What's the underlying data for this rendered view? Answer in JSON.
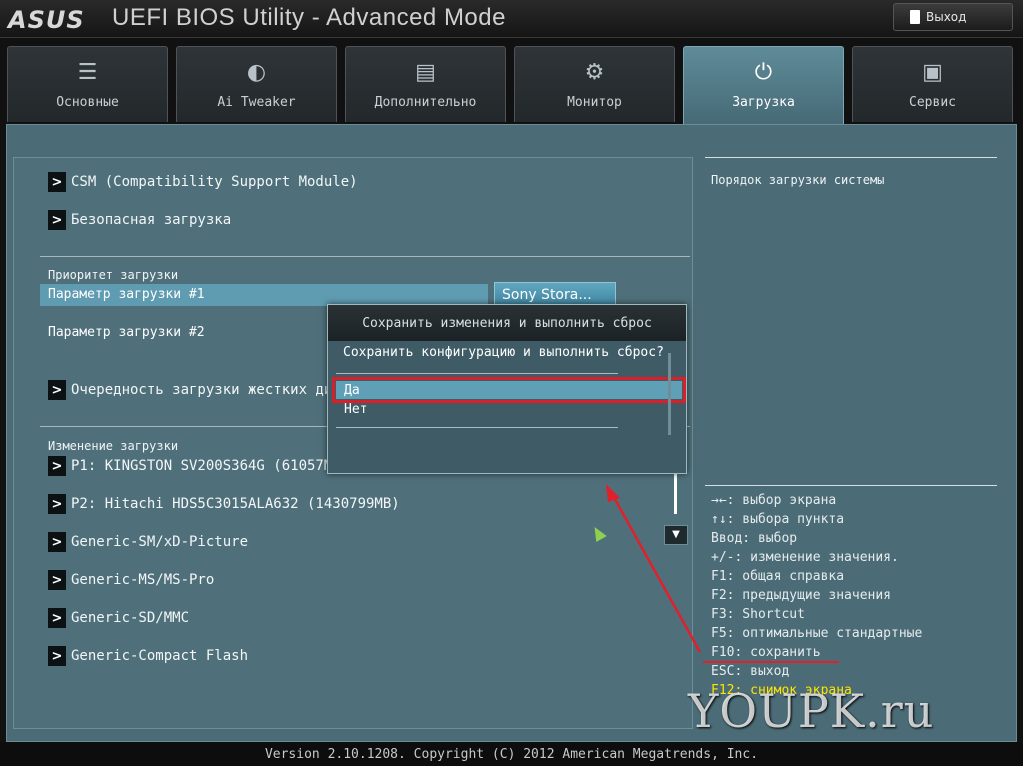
{
  "titlebar": {
    "logo": "ASUS",
    "title": "UEFI BIOS Utility - Advanced Mode",
    "exit_label": "Выход"
  },
  "tabs": [
    {
      "label": "Основные",
      "icon": "list-icon"
    },
    {
      "label": "Ai Tweaker",
      "icon": "tweaker-icon"
    },
    {
      "label": "Дополнительно",
      "icon": "advanced-icon"
    },
    {
      "label": "Монитор",
      "icon": "monitor-icon"
    },
    {
      "label": "Загрузка",
      "icon": "power-icon",
      "active": true
    },
    {
      "label": "Сервис",
      "icon": "toolbox-icon"
    }
  ],
  "boot": {
    "csm": "CSM (Compatibility Support Module)",
    "secure_boot": "Безопасная загрузка",
    "priority_section": "Приоритет загрузки",
    "option1_label": "Параметр загрузки #1",
    "option1_value": "Sony Stora...",
    "option2_label": "Параметр загрузки #2",
    "hdd_order": "Очередность загрузки жестких дис",
    "override_section": "Изменение загрузки",
    "devices": [
      "P1: KINGSTON SV200S364G   (61057M",
      "P2: Hitachi HDS5C3015ALA632   (1430799MB)",
      "Generic-SM/xD-Picture",
      "Generic-MS/MS-Pro",
      "Generic-SD/MMC",
      "Generic-Compact Flash"
    ]
  },
  "dialog": {
    "title": "Сохранить изменения и выполнить сброс",
    "question": "Сохранить конфигурацию и выполнить сброс?",
    "options": [
      "Да",
      "Нет"
    ]
  },
  "help": {
    "title": "Порядок загрузки системы",
    "keys": [
      "→←: выбор экрана",
      "↑↓: выбора пункта",
      "Ввод: выбор",
      "+/-: изменение значения.",
      "F1: общая справка",
      "F2: предыдущие значения",
      "F3: Shortcut",
      "F5: оптимальные стандартные",
      "F10: сохранить",
      "ESC: выход",
      "F12: снимок экрана"
    ]
  },
  "footer": "Version 2.10.1208. Copyright (C) 2012 American Megatrends, Inc.",
  "watermark": "YOUPK.ru",
  "colors": {
    "panel": "#4b6b76",
    "active_tab": "#5f8b98",
    "selection": "#5fa0b7",
    "annotation": "#e0202a",
    "f12_key": "#ffe600"
  }
}
